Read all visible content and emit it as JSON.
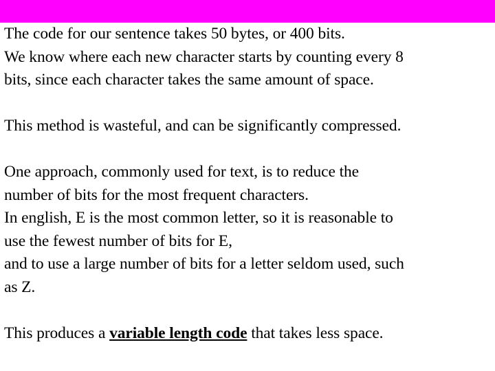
{
  "slide": {
    "background_color": "#ffffff",
    "top_band_color": "#ff00ff",
    "text_color": "#000000",
    "paragraphs": [
      {
        "id": "p1",
        "lines": [
          "The code for our sentence takes 50 bytes, or 400 bits.",
          "We know where each new character starts by counting every 8",
          "bits, since each character takes the same amount of space."
        ]
      },
      {
        "id": "p2",
        "lines": [
          "This method is wasteful, and can be significantly compressed."
        ]
      },
      {
        "id": "p3",
        "lines": [
          "One approach, commonly used for text, is to reduce the",
          "number of bits for the most frequent characters.",
          "In english, E is the most common letter, so it is reasonable to",
          "use the fewest number of bits for E,",
          "and to use a large number of bits for a letter seldom used, such",
          "as Z."
        ]
      }
    ],
    "final_paragraph": {
      "before": "This produces a ",
      "emphasis": "variable length code",
      "after": " that takes less space."
    }
  }
}
